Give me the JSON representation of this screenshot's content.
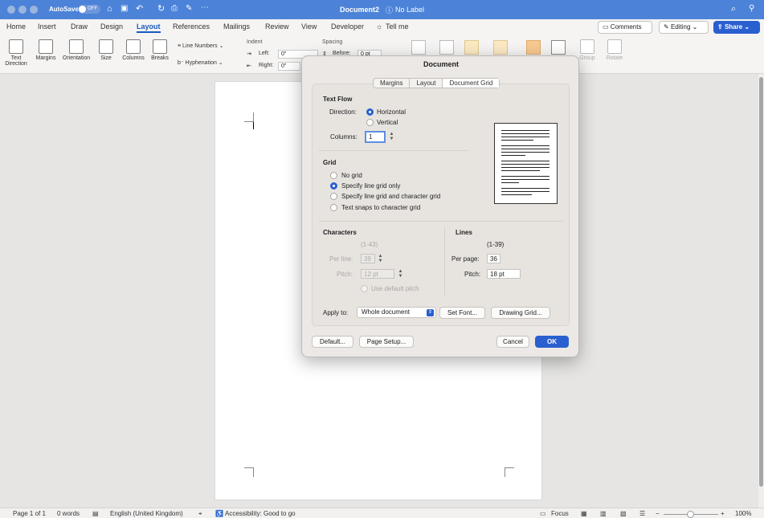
{
  "titlebar": {
    "autosave_label": "AutoSave",
    "autosave_state": "OFF",
    "doc_title": "Document2",
    "sensitivity": "No Label"
  },
  "tabs": [
    "Home",
    "Insert",
    "Draw",
    "Design",
    "Layout",
    "References",
    "Mailings",
    "Review",
    "View",
    "Developer",
    "Tell me"
  ],
  "header_buttons": {
    "comments": "Comments",
    "editing": "Editing",
    "share": "Share"
  },
  "ribbon": {
    "text_direction": "Text Direction",
    "margins": "Margins",
    "orientation": "Orientation",
    "size": "Size",
    "columns": "Columns",
    "breaks": "Breaks",
    "line_numbers": "Line Numbers",
    "hyphenation": "Hyphenation",
    "indent": "Indent",
    "indent_left_label": "Left:",
    "indent_left_value": "0\"",
    "indent_right_label": "Right:",
    "indent_right_value": "0\"",
    "spacing": "Spacing",
    "before_label": "Before:",
    "before_value": "0 pt",
    "group": "Group",
    "rotate": "Rotate"
  },
  "dialog": {
    "title": "Document",
    "tabs": [
      "Margins",
      "Layout",
      "Document Grid"
    ],
    "text_flow": {
      "heading": "Text Flow",
      "direction_label": "Direction:",
      "horizontal": "Horizontal",
      "vertical": "Vertical",
      "columns_label": "Columns:",
      "columns_value": "1"
    },
    "grid": {
      "heading": "Grid",
      "options": [
        "No grid",
        "Specify line grid only",
        "Specify line grid and character grid",
        "Text snaps to character grid"
      ]
    },
    "characters": {
      "heading": "Characters",
      "range": "(1-43)",
      "per_line_label": "Per line:",
      "per_line_value": "39",
      "pitch_label": "Pitch:",
      "pitch_value": "12 pt",
      "use_default_pitch": "Use default pitch"
    },
    "lines": {
      "heading": "Lines",
      "range": "(1-39)",
      "per_page_label": "Per page:",
      "per_page_value": "36",
      "pitch_label": "Pitch:",
      "pitch_value": "18 pt"
    },
    "apply_to_label": "Apply to:",
    "apply_to_value": "Whole document",
    "set_font": "Set Font...",
    "drawing_grid": "Drawing Grid...",
    "default": "Default...",
    "page_setup": "Page Setup...",
    "cancel": "Cancel",
    "ok": "OK"
  },
  "status": {
    "page": "Page 1 of 1",
    "words": "0 words",
    "language": "English (United Kingdom)",
    "accessibility": "Accessibility: Good to go",
    "focus": "Focus",
    "zoom": "100%"
  },
  "colors": {
    "accent": "#2a5fcf",
    "titlebar": "#4c83d8"
  }
}
